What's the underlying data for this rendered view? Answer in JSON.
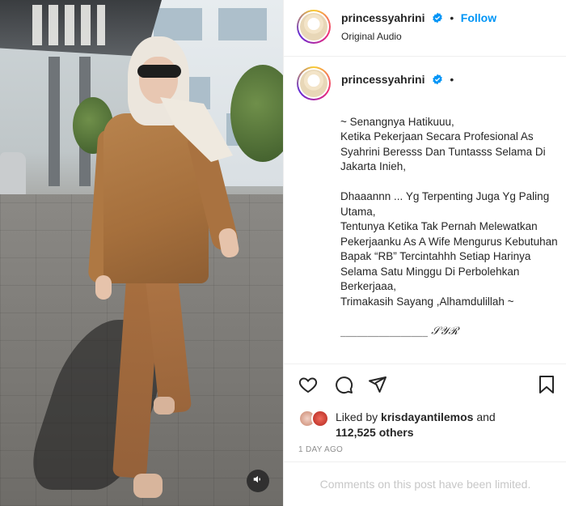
{
  "post": {
    "username": "princessyahrini",
    "separator": "•",
    "follow_label": "Follow",
    "audio": "Original Audio",
    "caption": "~ Senangnya Hatikuuu,\nKetika Pekerjaan Secara Profesional As Syahrini Beresss Dan Tuntasss Selama Di Jakarta Inieh,\n\nDhaaannn ... Yg Terpenting Juga Yg Paling Utama,\nTentunya Ketika Tak Pernah Melewatkan Pekerjaanku As A Wife Mengurus Kebutuhan Bapak “RB” Tercintahhh Setiap Harinya Selama Satu Minggu Di Perbolehkan Berkerjaaa,\nTrimakasih Sayang ,Alhamdulillah ~",
    "signature": "________________ 𝒮𝒴ℛ",
    "liked_by_prefix": "Liked by",
    "liked_by_user": "krisdayantilemos",
    "liked_by_and": "and",
    "likes_others": "112,525 others",
    "timestamp": "1 DAY AGO",
    "comments_limited": "Comments on this post have been limited."
  },
  "icons": {
    "verified": "verified-badge-icon",
    "like": "heart-icon",
    "comment": "comment-icon",
    "share": "paper-plane-icon",
    "save": "bookmark-icon",
    "sound": "speaker-icon"
  },
  "colors": {
    "accent": "#0095f6",
    "text": "#262626",
    "muted": "#8e8e8e",
    "border": "#efefef"
  }
}
